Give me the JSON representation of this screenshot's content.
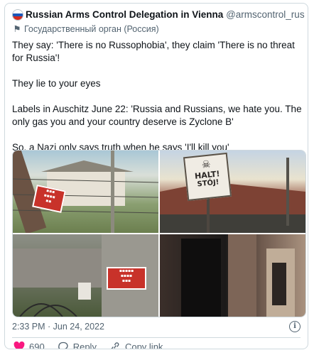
{
  "tweet": {
    "author_name": "Russian Arms Control Delegation in Vienna",
    "handle": "@armscontrol_rus",
    "label": "Государственный орган (Россия)",
    "paragraphs": [
      "They say: 'There is no Russophobia', they claim 'There is no threat for Russia'!",
      "They lie to your eyes",
      "Labels in Auschitz June 22: 'Russia and Russians, we hate you. The only gas you and your country deserve is Zyclone B'",
      "So, a Nazi only says truth when he says 'I'll kill you'"
    ],
    "timestamp": "2:33 PM · Jun 24, 2022"
  },
  "media": {
    "sign_halt": "HALT!",
    "sign_stoj": "STÓJ!"
  },
  "actions": {
    "like_count": "690",
    "reply_label": "Reply",
    "copy_link_label": "Copy link"
  },
  "colors": {
    "text": "#0f1419",
    "secondary": "#536471",
    "border": "#cfd9de",
    "like_red": "#f91880"
  },
  "icons": [
    "government-flag-icon",
    "info-icon",
    "heart-icon",
    "reply-icon",
    "link-icon"
  ]
}
